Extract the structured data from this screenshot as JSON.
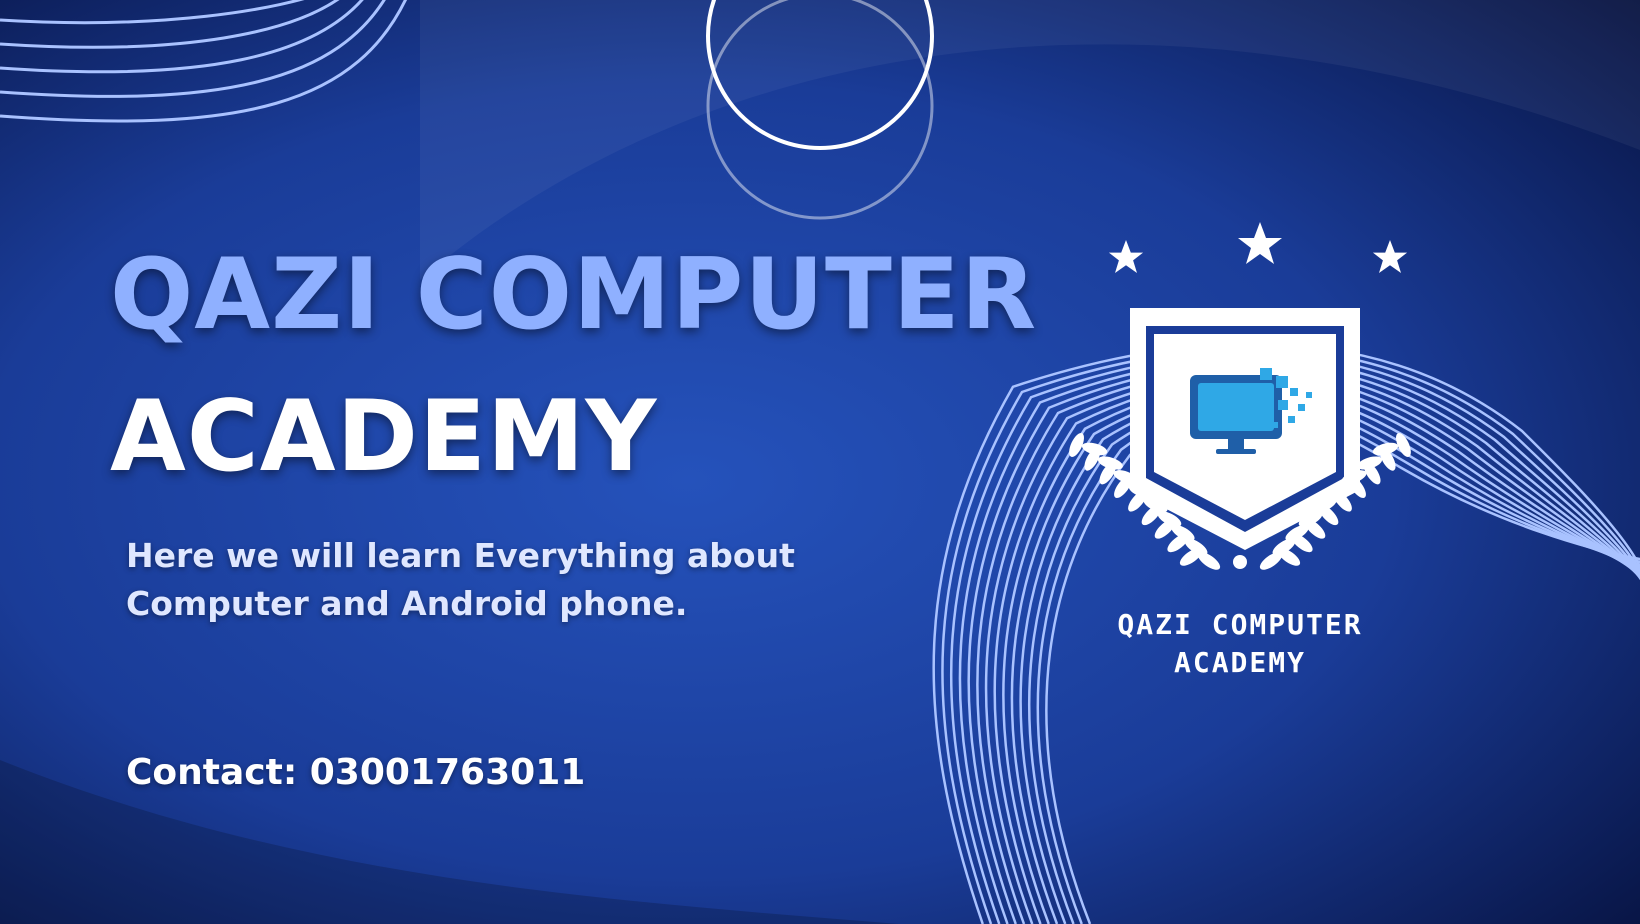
{
  "banner": {
    "title_line_1": "QAZI COMPUTER",
    "title_line_2": "ACADEMY",
    "tagline": "Here we will learn Everything about Computer and Android phone.",
    "contact": "Contact: 03001763011"
  },
  "logo": {
    "text_line_1": "QAZI COMPUTER",
    "text_line_2": "ACADEMY",
    "star_count": 3,
    "icon": "monitor-pixel-icon"
  },
  "colors": {
    "background": "#1a3c98",
    "background_dark": "#07123f",
    "title_accent": "#8fb0ff",
    "white": "#ffffff",
    "tagline": "#dfe7ff",
    "line_art": "#a9c2ff",
    "monitor_dark": "#1f5fa8",
    "monitor_light": "#2fa8e6"
  }
}
